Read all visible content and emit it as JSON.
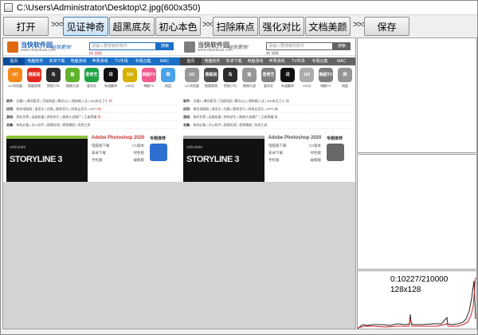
{
  "window": {
    "title": "C:\\Users\\Administrator\\Desktop\\2.jpg(600x350)"
  },
  "toolbar": {
    "open": "打开",
    "arrow": ">>>",
    "see_magic": "见证神奇",
    "super_black": "超黑底灰",
    "original_color": "初心本色",
    "remove_spots": "扫除麻点",
    "enhance_contrast": "强化对比",
    "document_beauty": "文档美颜",
    "save": "保存"
  },
  "preview": {
    "logo_text": "当快软件园",
    "logo_sub": "www.downkuai.com",
    "slogan": "当快更快!",
    "search_placeholder": "请输入要搜索的软件",
    "search_button": "搜索",
    "hot_text": "热门搜索",
    "nav": [
      "首页",
      "电脑软件",
      "安卓下载",
      "电脑游戏",
      "苹果游戏",
      "TV市场",
      "专题合集",
      "MAC"
    ],
    "icons": [
      {
        "label": "UC浏览器",
        "text": "UC",
        "color": "#f28a1a"
      },
      {
        "label": "搜狐视频",
        "text": "搜狐视频",
        "color": "#e02a1e"
      },
      {
        "label": "愤怒小鸟",
        "text": "鸟",
        "color": "#2b2b2b"
      },
      {
        "label": "植物大战",
        "text": "植",
        "color": "#5fb32c"
      },
      {
        "label": "爱奇艺",
        "text": "爱奇艺",
        "color": "#1fa443"
      },
      {
        "label": "有道翻译",
        "text": "词",
        "color": "#111111"
      },
      {
        "label": "100分",
        "text": "100",
        "color": "#d6b100"
      },
      {
        "label": "韩剧TV",
        "text": "韩剧TV",
        "color": "#f05a8d"
      },
      {
        "label": "网盘",
        "text": "网",
        "color": "#4aa3e8"
      }
    ],
    "rows": [
      {
        "cat": "软件:",
        "text": "迅雷9 | 暴风影音 | 百度网盘 | 腾讯QQ | 搜狗输入法 | 360安全卫士",
        "hot": "热"
      },
      {
        "cat": "应用:",
        "text": "微信电脑版 | 爱奇艺 | 优酷 | 酷狗音乐 | 网易云音乐 | WPS",
        "hot": "新"
      },
      {
        "cat": "游戏:",
        "text": "我的世界 | 英雄联盟 | 绝地求生 | 植物大战僵尸 | 王者荣耀",
        "hot": "热"
      },
      {
        "cat": "合集:",
        "text": "装机必备 | 办公软件 | 图像处理 | 视频播放 | 系统工具",
        "hot": ""
      }
    ],
    "banner_brand": "articulate",
    "banner_title": "STORYLINE 3",
    "promo_title": "Adobe Photoshop 2020",
    "promo_rows": [
      [
        "电脑版下载",
        "CC版本"
      ],
      [
        "安卓下载",
        "绿色版"
      ],
      [
        "手机版",
        "破解版"
      ]
    ],
    "rec_title": "专题推荐"
  },
  "histogram": {
    "count_text": "0:10227/210000",
    "size_text": "128x128",
    "stroke_dark": "#222222",
    "stroke_red": "#cc2020"
  }
}
